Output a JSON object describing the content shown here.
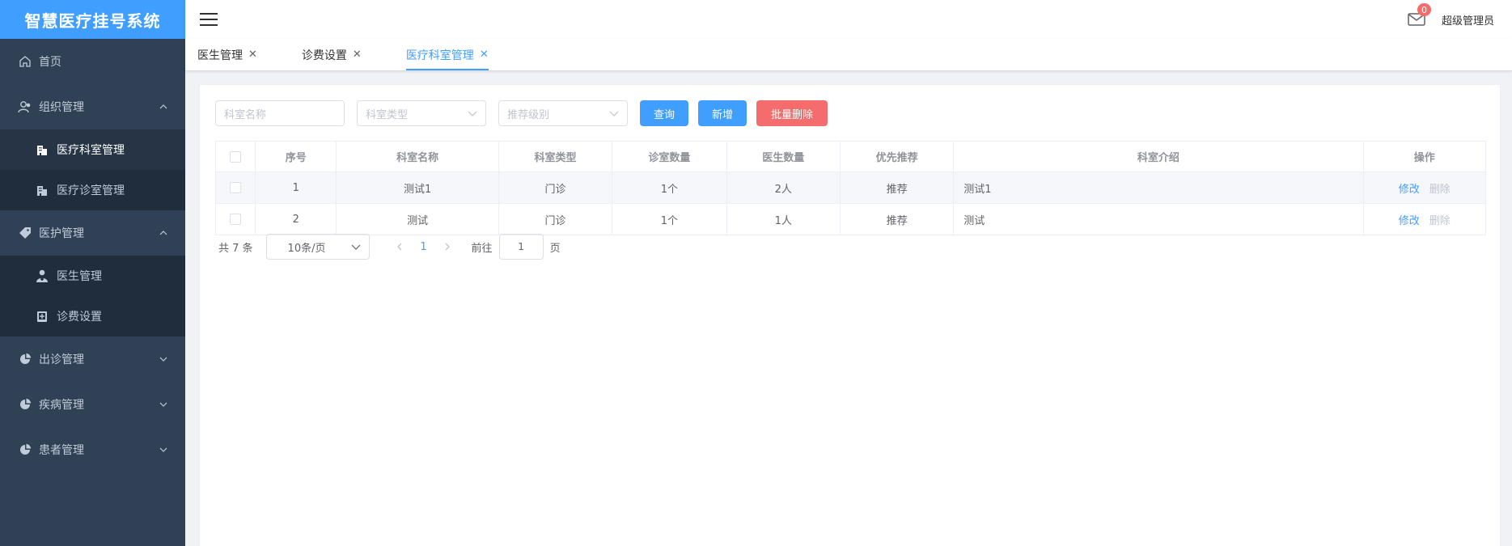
{
  "app": {
    "logo": "智慧医疗挂号系统"
  },
  "colors": {
    "primary": "#409eff",
    "danger": "#f56c6c",
    "sidebar_bg": "#304156",
    "submenu_bg": "#1f2d3d"
  },
  "sidebar": {
    "home": {
      "label": "首页",
      "icon": "home-icon"
    },
    "groups": [
      {
        "label": "组织管理",
        "icon": "users-icon",
        "expanded": true,
        "items": [
          {
            "label": "医疗科室管理",
            "icon": "building-icon",
            "active": true
          },
          {
            "label": "医疗诊室管理",
            "icon": "building-icon",
            "active": false
          }
        ]
      },
      {
        "label": "医护管理",
        "icon": "tag-icon",
        "expanded": true,
        "items": [
          {
            "label": "医生管理",
            "icon": "doctor-icon",
            "active": false
          },
          {
            "label": "诊费设置",
            "icon": "book-icon",
            "active": false
          }
        ]
      },
      {
        "label": "出诊管理",
        "icon": "pie-icon",
        "expanded": false,
        "items": []
      },
      {
        "label": "疾病管理",
        "icon": "pie-icon",
        "expanded": false,
        "items": []
      },
      {
        "label": "患者管理",
        "icon": "pie-icon",
        "expanded": false,
        "items": []
      }
    ]
  },
  "header": {
    "badge_count": "0",
    "username": "超级管理员"
  },
  "tabs": [
    {
      "label": "医生管理",
      "active": false
    },
    {
      "label": "诊费设置",
      "active": false
    },
    {
      "label": "医疗科室管理",
      "active": true
    }
  ],
  "filters": {
    "name_placeholder": "科室名称",
    "type_placeholder": "科室类型",
    "level_placeholder": "推荐级别",
    "query_label": "查询",
    "add_label": "新增",
    "batch_delete_label": "批量删除"
  },
  "table": {
    "columns": [
      "序号",
      "科室名称",
      "科室类型",
      "诊室数量",
      "医生数量",
      "优先推荐",
      "科室介绍",
      "操作"
    ],
    "rows": [
      {
        "index": "1",
        "name": "测试1",
        "type": "门诊",
        "rooms": "1个",
        "doctors": "2人",
        "recommend": "推荐",
        "intro": "测试1",
        "edit": "修改",
        "delete": "删除"
      },
      {
        "index": "2",
        "name": "测试",
        "type": "门诊",
        "rooms": "1个",
        "doctors": "1人",
        "recommend": "推荐",
        "intro": "测试",
        "edit": "修改",
        "delete": "删除"
      }
    ]
  },
  "pagination": {
    "total": "共 7 条",
    "page_size": "10条/页",
    "current": "1",
    "goto_label": "前往",
    "goto_value": "1",
    "page_suffix": "页"
  }
}
